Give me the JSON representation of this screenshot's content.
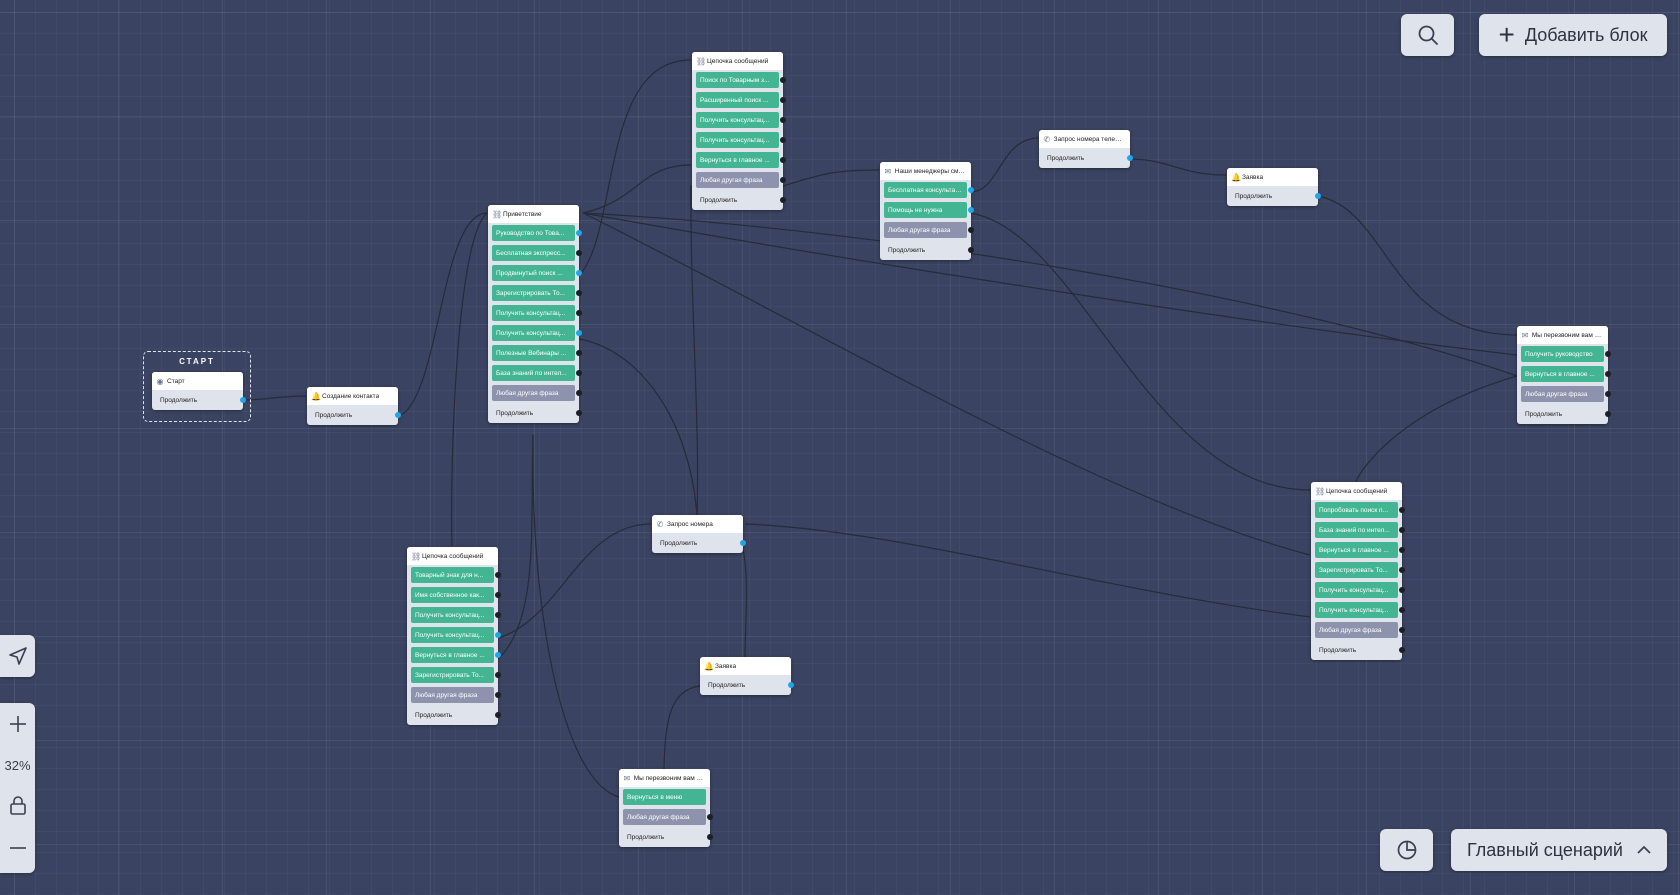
{
  "toolbar": {
    "search_icon": "search-icon",
    "add_block_label": "Добавить блок"
  },
  "zoom": {
    "level": "32%"
  },
  "scenario": {
    "label": "Главный сценарий"
  },
  "start": {
    "title": "СТАРТ",
    "node_title": "Старт",
    "continue": "Продолжить"
  },
  "colors": {
    "canvas": "#3a4361",
    "edge": "#262b3b",
    "port_active": "#1fa5e8",
    "button_green": "#43b593",
    "button_gray": "#8d93ad"
  },
  "nodes": {
    "create_contact": {
      "title": "Создание контакта",
      "continue": "Продолжить"
    },
    "greeting": {
      "title": "Приветствие",
      "buttons": [
        "Руководство по Това...",
        "Бесплатная экспресс...",
        "Продвинутый поиск ...",
        "Зарегистрировать То...",
        "Получить консультац...",
        "Получить консультац...",
        "Полезные Вебинары ...",
        "База знаний по интел..."
      ],
      "any_phrase": "Любая другая фраза",
      "continue": "Продолжить"
    },
    "chain_top": {
      "title": "Цепочка сообщений",
      "buttons": [
        "Поиск по Товарным з...",
        "Расширенный поиск ...",
        "Получить консультац...",
        "Получить консультац...",
        "Вернуться в главное ..."
      ],
      "any_phrase": "Любая другая фраза",
      "continue": "Продолжить"
    },
    "managers": {
      "title": "Наши менеджеры смог...",
      "buttons": [
        "Бесплатная консультация",
        "Помощь не нужна"
      ],
      "any_phrase": "Любая другая фраза",
      "continue": "Продолжить"
    },
    "phone_request_top": {
      "title": "Запрос номера телефо...",
      "continue": "Продолжить"
    },
    "request_top": {
      "title": "Заявка",
      "continue": "Продолжить"
    },
    "callback_right": {
      "title": "Мы перезвоним вам в ...",
      "buttons": [
        "Получить руководство",
        "Вернуться в главное ..."
      ],
      "any_phrase": "Любая другая фраза",
      "continue": "Продолжить"
    },
    "chain_right": {
      "title": "Цепочка сообщений",
      "buttons": [
        "Попробовать поиск п...",
        "База знаний по интел...",
        "Вернуться в главное ...",
        "Зарегистрировать То...",
        "Получить консультац...",
        "Получить консультац..."
      ],
      "any_phrase": "Любая другая фраза",
      "continue": "Продолжить"
    },
    "chain_left": {
      "title": "Цепочка сообщений",
      "buttons": [
        "Товарный знак для н...",
        "Имя собственное как...",
        "Получить консультац...",
        "Получить консультац...",
        "Вернуться в главное ...",
        "Зарегистрировать То..."
      ],
      "any_phrase": "Любая другая фраза",
      "continue": "Продолжить"
    },
    "phone_request_mid": {
      "title": "Запрос номера",
      "continue": "Продолжить"
    },
    "request_mid": {
      "title": "Заявка",
      "continue": "Продолжить"
    },
    "callback_bottom": {
      "title": "Мы перезвоним вам оч...",
      "buttons": [
        "Вернуться в меню"
      ],
      "any_phrase": "Любая другая фраза",
      "continue": "Продолжить"
    }
  }
}
